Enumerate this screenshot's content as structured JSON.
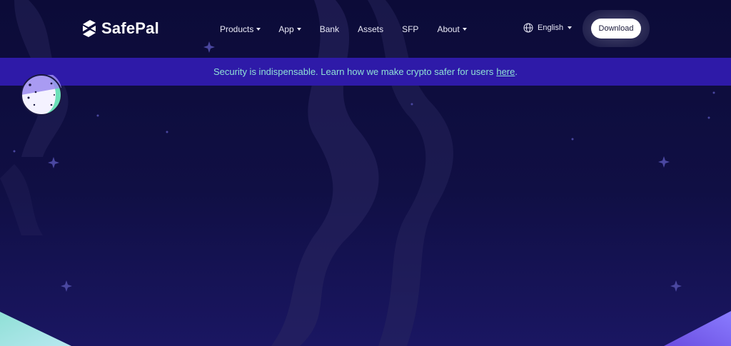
{
  "brand": {
    "name": "SafePal"
  },
  "nav": {
    "items": [
      {
        "label": "Products",
        "has_dropdown": true
      },
      {
        "label": "App",
        "has_dropdown": true
      },
      {
        "label": "Bank",
        "has_dropdown": false
      },
      {
        "label": "Assets",
        "has_dropdown": false
      },
      {
        "label": "SFP",
        "has_dropdown": false
      },
      {
        "label": "About",
        "has_dropdown": true
      }
    ]
  },
  "language": {
    "label": "English",
    "icon": "globe-icon"
  },
  "header": {
    "download_label": "Download"
  },
  "banner": {
    "text": "Security is indispensable. Learn how we make crypto safer for users",
    "link_text": "here",
    "trailing": "."
  },
  "colors": {
    "background": "#0c0b38",
    "banner_bg": "#2e1aa8",
    "banner_text": "#8fe0d6",
    "button_bg": "#ffffff"
  }
}
